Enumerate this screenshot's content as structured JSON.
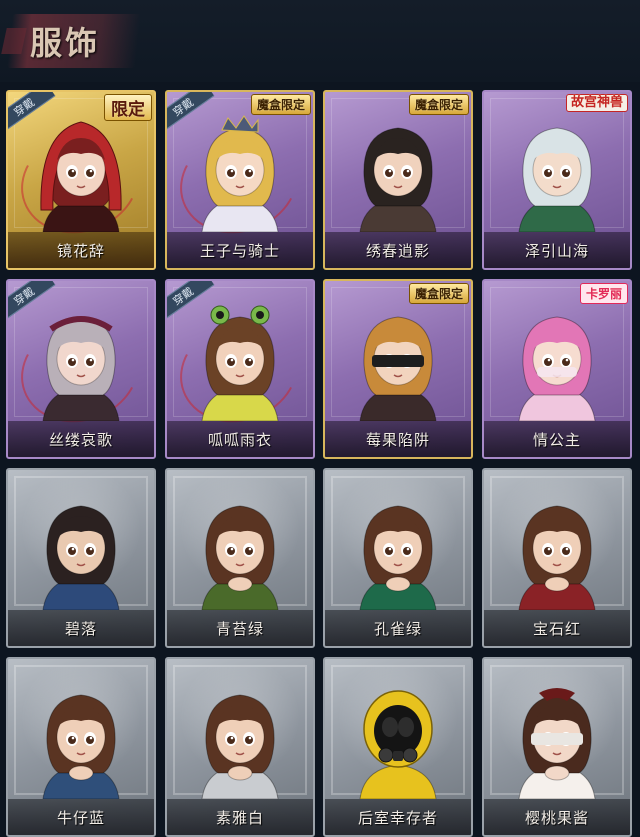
{
  "section": {
    "title": "服饰"
  },
  "worn_label": "穿戴",
  "cards": [
    {
      "name": "镜花辞",
      "tier": "gold",
      "worn": true,
      "badge": "限定",
      "badge_style": "big",
      "hair": "#7a1f1f",
      "hood": "#b8282a",
      "skin": "#f2d4c2",
      "cloth": "#3a1414"
    },
    {
      "name": "王子与骑士",
      "tier": "purple",
      "worn": true,
      "badge": "魔盒限定",
      "badge_style": "normal",
      "hair": "#e1b94d",
      "hood": "#4c5a78",
      "skin": "#f5d9c4",
      "cloth": "#e8e6f2"
    },
    {
      "name": "绣春逍影",
      "tier": "purple",
      "worn": false,
      "badge": "魔盒限定",
      "badge_style": "normal",
      "hair": "#2a2320",
      "hood": "#2a2320",
      "skin": "#f0d2bd",
      "cloth": "#4a3a34"
    },
    {
      "name": "泽引山海",
      "tier": "purple",
      "worn": false,
      "badge": "故宫神兽",
      "badge_style": "event",
      "hair": "#d9e3e6",
      "hood": "#c9d4d8",
      "skin": "#f3dccb",
      "cloth": "#2f6a48"
    },
    {
      "name": "丝缕哀歌",
      "tier": "purple",
      "worn": true,
      "badge": "",
      "badge_style": "none",
      "hair": "#b9b0b8",
      "hood": "#6b1f3a",
      "skin": "#f1d7cd",
      "cloth": "#3a2a30"
    },
    {
      "name": "呱呱雨衣",
      "tier": "purple",
      "worn": true,
      "badge": "",
      "badge_style": "none",
      "hair": "#6b4226",
      "hood": "#79b94a",
      "skin": "#f1d1bb",
      "cloth": "#d8d84a"
    },
    {
      "name": "莓果陷阱",
      "tier": "purple",
      "worn": false,
      "badge": "魔盒限定",
      "badge_style": "normal",
      "hair": "#c88a3a",
      "hood": "#8a2a1a",
      "skin": "#f2d4be",
      "cloth": "#3a2a2a"
    },
    {
      "name": "情公主",
      "tier": "purple",
      "worn": false,
      "badge": "卡罗丽",
      "badge_style": "pink",
      "hair": "#e276b6",
      "hood": "#e276b6",
      "skin": "#f6dcd0",
      "cloth": "#f0c6de"
    },
    {
      "name": "碧落",
      "tier": "grey",
      "worn": false,
      "badge": "",
      "badge_style": "none",
      "hair": "#2b2120",
      "hood": "#2b2120",
      "skin": "#e9c9b0",
      "cloth": "#2d4a7a"
    },
    {
      "name": "青苔绿",
      "tier": "grey",
      "worn": false,
      "badge": "",
      "badge_style": "none",
      "hair": "#5a3422",
      "hood": "#5a3422",
      "skin": "#efcfb8",
      "cloth": "#4a6a2a"
    },
    {
      "name": "孔雀绿",
      "tier": "grey",
      "worn": false,
      "badge": "",
      "badge_style": "none",
      "hair": "#5a3422",
      "hood": "#5a3422",
      "skin": "#efcfb8",
      "cloth": "#1e6a4a"
    },
    {
      "name": "宝石红",
      "tier": "grey",
      "worn": false,
      "badge": "",
      "badge_style": "none",
      "hair": "#5a3422",
      "hood": "#5a3422",
      "skin": "#efcfb8",
      "cloth": "#8a2226"
    },
    {
      "name": "牛仔蓝",
      "tier": "grey",
      "worn": false,
      "badge": "",
      "badge_style": "none",
      "hair": "#5a3422",
      "hood": "#5a3422",
      "skin": "#efcfb8",
      "cloth": "#2f4f7a"
    },
    {
      "name": "素雅白",
      "tier": "grey",
      "worn": false,
      "badge": "",
      "badge_style": "none",
      "hair": "#5a3422",
      "hood": "#5a3422",
      "skin": "#efcfb8",
      "cloth": "#c9ccd0"
    },
    {
      "name": "后室幸存者",
      "tier": "grey",
      "worn": false,
      "badge": "",
      "badge_style": "none",
      "hair": "#e7c21e",
      "hood": "#e7c21e",
      "skin": "#1a1a1a",
      "cloth": "#e7c21e"
    },
    {
      "name": "樱桃果酱",
      "tier": "grey",
      "worn": false,
      "badge": "",
      "badge_style": "none",
      "hair": "#4a2a1e",
      "hood": "#6a1a1a",
      "skin": "#f2d8c8",
      "cloth": "#f5f0ec"
    }
  ]
}
